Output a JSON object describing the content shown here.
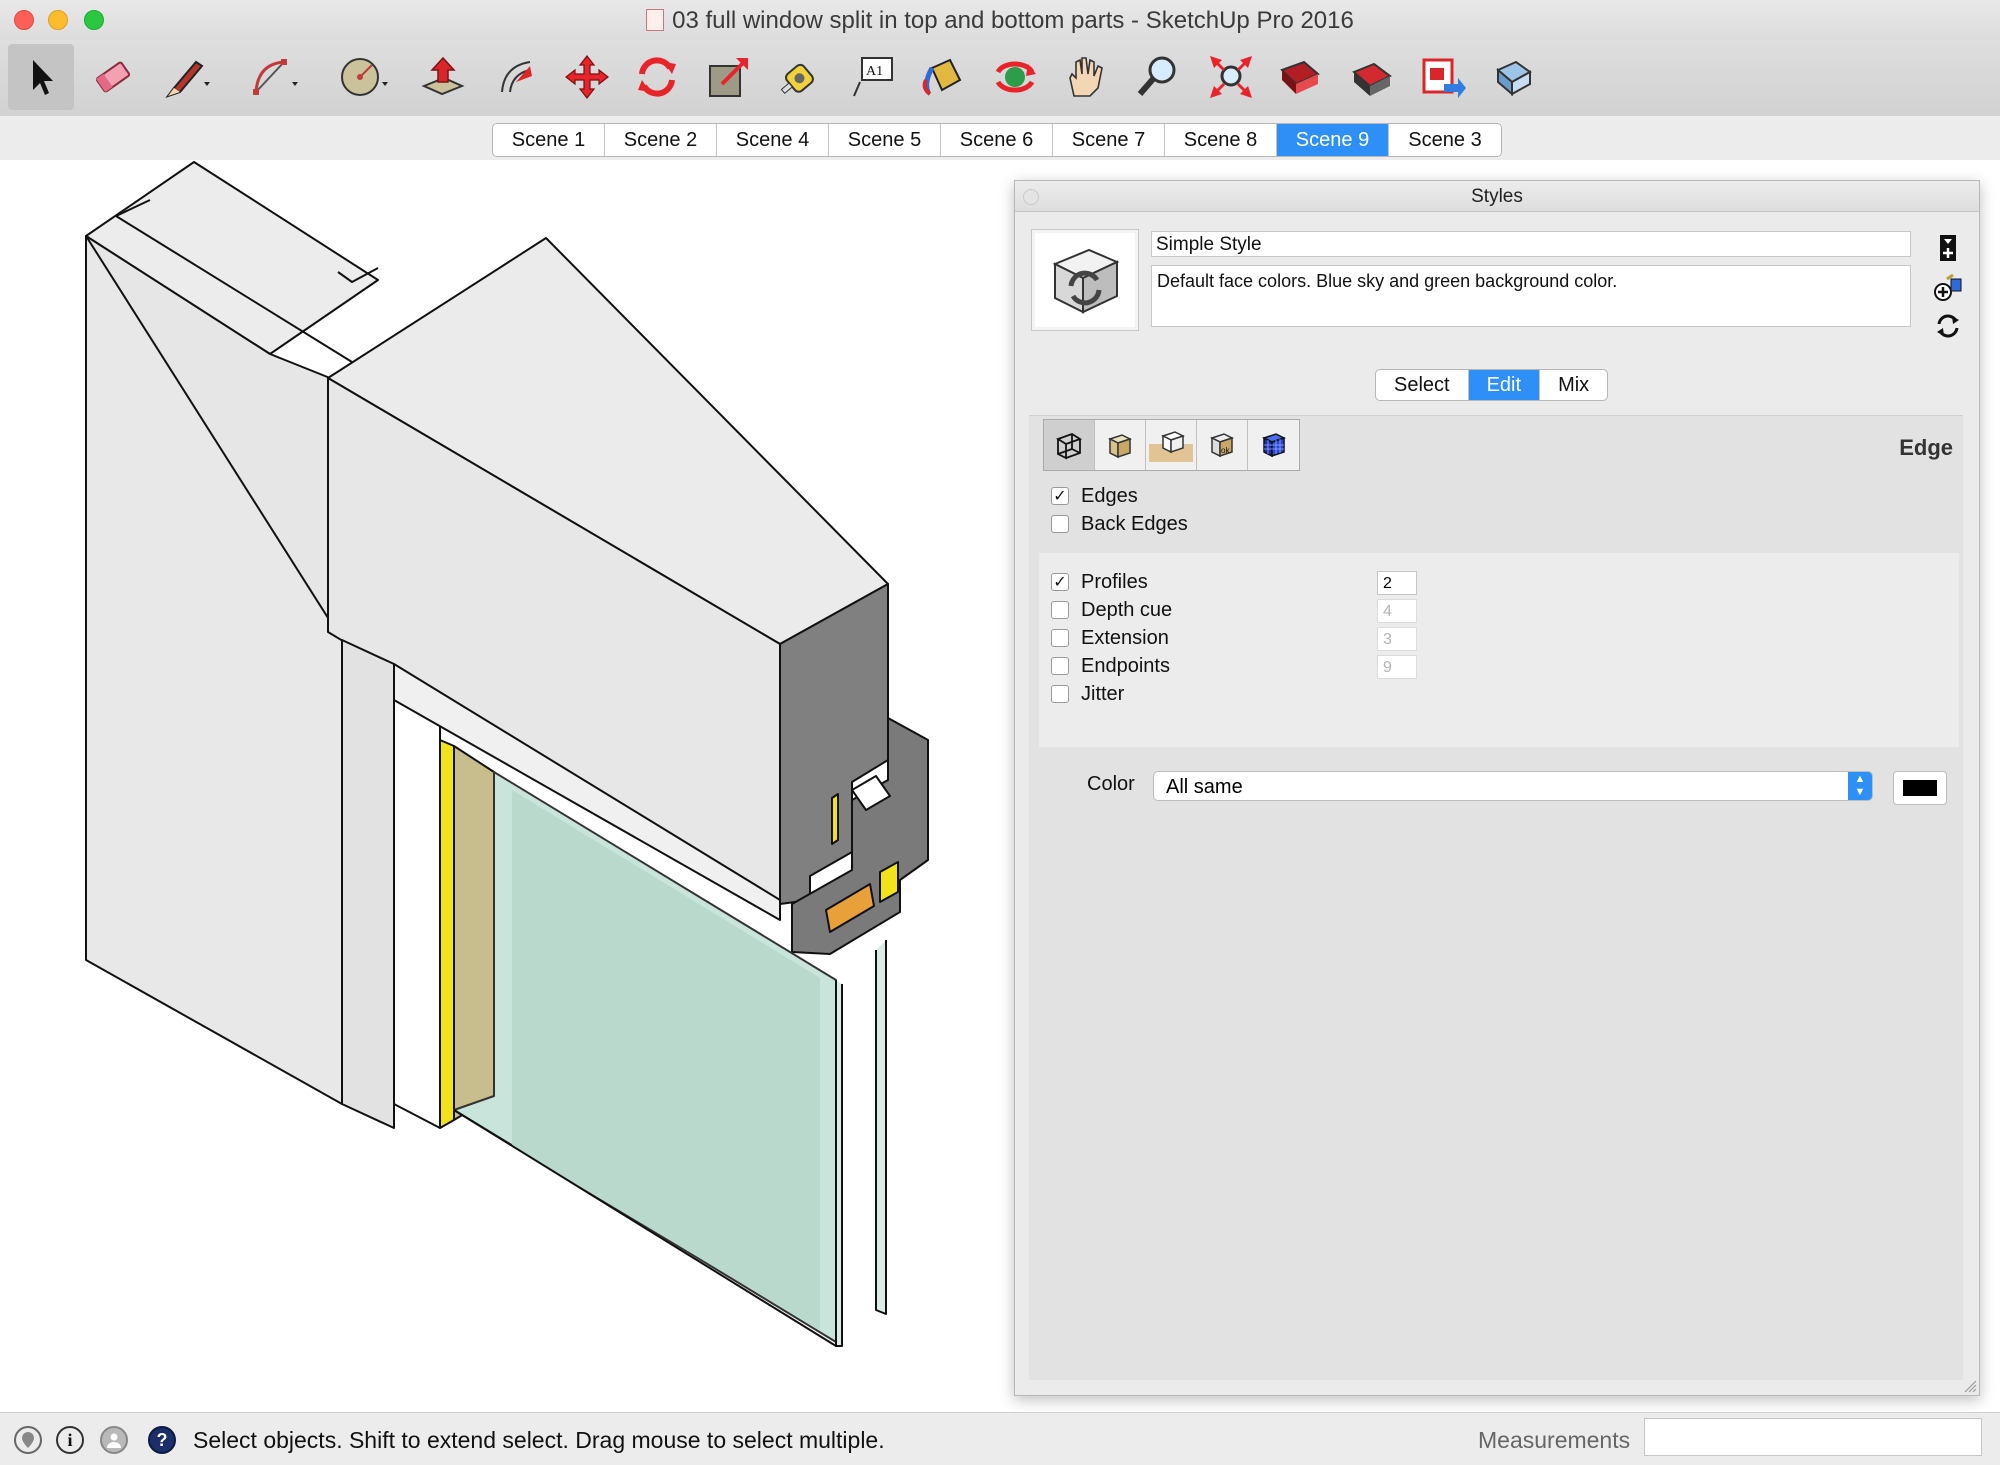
{
  "window": {
    "title": "03 full window split in top and bottom parts - SketchUp Pro 2016"
  },
  "toolbar": {
    "tools": [
      {
        "name": "select-tool-icon",
        "label": "Select"
      },
      {
        "name": "eraser-tool-icon",
        "label": "Eraser"
      },
      {
        "name": "pencil-line-tool-icon",
        "label": "Line"
      },
      {
        "name": "arc-tool-icon",
        "label": "Arc"
      },
      {
        "name": "circle-tool-icon",
        "label": "Shapes"
      },
      {
        "name": "push-pull-tool-icon",
        "label": "Push/Pull"
      },
      {
        "name": "offset-tool-icon",
        "label": "Offset"
      },
      {
        "name": "move-tool-icon",
        "label": "Move"
      },
      {
        "name": "rotate-tool-icon",
        "label": "Rotate"
      },
      {
        "name": "scale-tool-icon",
        "label": "Scale"
      },
      {
        "name": "tape-measure-tool-icon",
        "label": "Tape Measure"
      },
      {
        "name": "text-tool-icon",
        "label": "Text"
      },
      {
        "name": "paint-bucket-tool-icon",
        "label": "Paint Bucket"
      },
      {
        "name": "orbit-tool-icon",
        "label": "Orbit"
      },
      {
        "name": "pan-tool-icon",
        "label": "Pan"
      },
      {
        "name": "zoom-tool-icon",
        "label": "Zoom"
      },
      {
        "name": "zoom-extents-tool-icon",
        "label": "Zoom Extents"
      },
      {
        "name": "3d-warehouse-icon",
        "label": "3D Warehouse"
      },
      {
        "name": "extension-warehouse-icon",
        "label": "Extension Warehouse"
      },
      {
        "name": "send-to-layout-icon",
        "label": "Send to LayOut"
      },
      {
        "name": "component-icon",
        "label": "Components"
      }
    ]
  },
  "scenes": {
    "tabs": [
      "Scene 1",
      "Scene 2",
      "Scene 4",
      "Scene 5",
      "Scene 6",
      "Scene 7",
      "Scene 8",
      "Scene 9",
      "Scene 3"
    ],
    "active": "Scene 9"
  },
  "styles_panel": {
    "title": "Styles",
    "style_name": "Simple Style",
    "style_description": "Default face colors. Blue sky and green background color.",
    "modes": [
      "Select",
      "Edit",
      "Mix"
    ],
    "active_mode": "Edit",
    "section_heading": "Edge",
    "category_icons": [
      "edge-settings-icon",
      "face-settings-icon",
      "background-settings-icon",
      "watermark-settings-icon",
      "modeling-settings-icon"
    ],
    "edge_options": [
      {
        "label": "Edges",
        "checked": true
      },
      {
        "label": "Back Edges",
        "checked": false
      }
    ],
    "profile_options": [
      {
        "label": "Profiles",
        "checked": true,
        "value": "2",
        "enabled": true
      },
      {
        "label": "Depth cue",
        "checked": false,
        "value": "4",
        "enabled": false
      },
      {
        "label": "Extension",
        "checked": false,
        "value": "3",
        "enabled": false
      },
      {
        "label": "Endpoints",
        "checked": false,
        "value": "9",
        "enabled": false
      },
      {
        "label": "Jitter",
        "checked": false
      }
    ],
    "color_label": "Color",
    "color_value": "All same",
    "swatch_color": "#000000"
  },
  "statusbar": {
    "message": "Select objects. Shift to extend select. Drag mouse to select multiple.",
    "measurements_label": "Measurements",
    "measurements_value": ""
  },
  "colors": {
    "accent": "#2e8ff7",
    "model_gray_light": "#e8e8e8",
    "model_gray_dark": "#7f7f7f",
    "glass": "#c9e4da",
    "yellow_seal": "#f2e21a",
    "wood": "#c8bd8d"
  }
}
